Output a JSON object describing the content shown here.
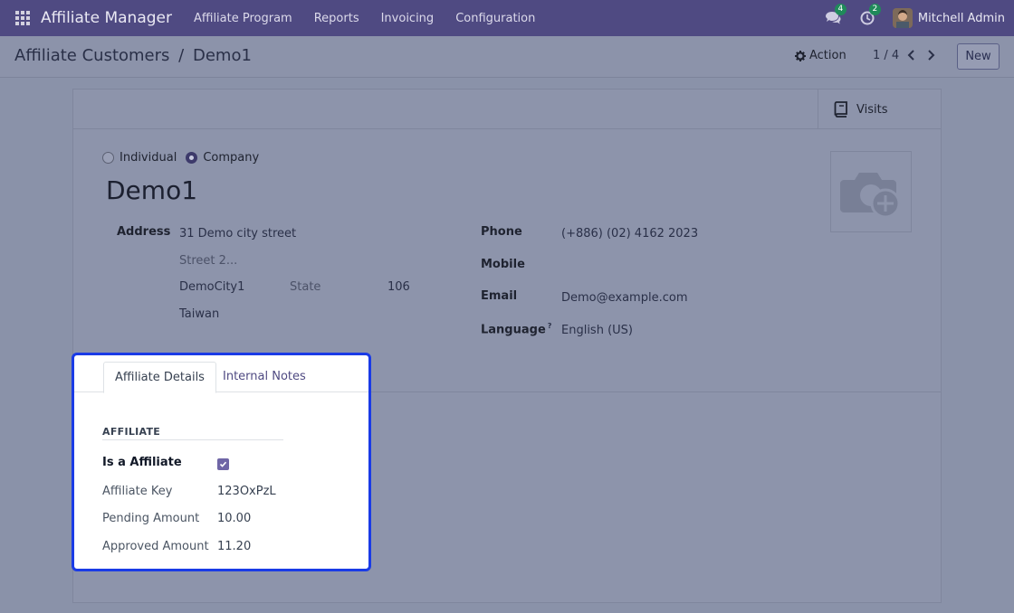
{
  "navbar": {
    "brand": "Affiliate Manager",
    "menu": [
      "Affiliate Program",
      "Reports",
      "Invoicing",
      "Configuration"
    ],
    "messages_count": "4",
    "activities_count": "2",
    "user": "Mitchell Admin"
  },
  "control": {
    "breadcrumb_parent": "Affiliate Customers",
    "breadcrumb_sep": "/",
    "breadcrumb_current": "Demo1",
    "action_label": "Action",
    "pager": "1 / 4",
    "new_label": "New"
  },
  "button_box": {
    "visits_label": "Visits"
  },
  "company_type": {
    "individual": "Individual",
    "company": "Company",
    "selected": "company"
  },
  "partner": {
    "name": "Demo1"
  },
  "address": {
    "label": "Address",
    "street": "31 Demo city  street",
    "street2_placeholder": "Street 2...",
    "city": "DemoCity1",
    "state_placeholder": "State",
    "zip": "106",
    "country": "Taiwan"
  },
  "contact": {
    "phone_label": "Phone",
    "phone": "(+886) (02) 4162 2023",
    "mobile_label": "Mobile",
    "mobile": "",
    "email_label": "Email",
    "email": "Demo@example.com",
    "language_label": "Language",
    "language_help": "?",
    "language": "English (US)"
  },
  "notebook": {
    "tabs": [
      "Affiliate Details",
      "Internal Notes"
    ],
    "active_tab": 0,
    "group_title": "AFFILIATE",
    "fields": {
      "is_affiliate_label": "Is a Affiliate",
      "is_affiliate": true,
      "key_label": "Affiliate Key",
      "key": "123OxPzL",
      "pending_label": "Pending Amount",
      "pending": "10.00",
      "approved_label": "Approved Amount",
      "approved": "11.20"
    }
  },
  "colors": {
    "navbar": "#4f4a82",
    "highlight_border": "#1a3be6",
    "badge": "#1f8a5a",
    "checkbox": "#6f66a6"
  },
  "icons": [
    "apps-grid-icon",
    "chat-icon",
    "clock-icon",
    "gear-icon",
    "chevron-left-icon",
    "chevron-right-icon",
    "book-icon",
    "camera-plus-icon",
    "check-icon"
  ]
}
